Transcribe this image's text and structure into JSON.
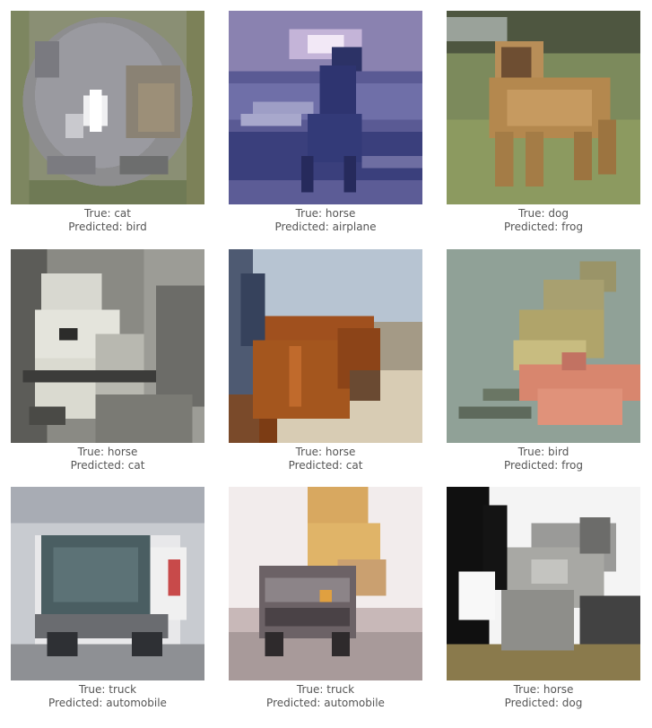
{
  "panels": [
    {
      "true_label": "True: cat",
      "predicted_label": "Predicted: bird",
      "subject": "cat"
    },
    {
      "true_label": "True: horse",
      "predicted_label": "Predicted: airplane",
      "subject": "horse"
    },
    {
      "true_label": "True: dog",
      "predicted_label": "Predicted: frog",
      "subject": "dog"
    },
    {
      "true_label": "True: horse",
      "predicted_label": "Predicted: cat",
      "subject": "horse"
    },
    {
      "true_label": "True: horse",
      "predicted_label": "Predicted: cat",
      "subject": "horse"
    },
    {
      "true_label": "True: bird",
      "predicted_label": "Predicted: frog",
      "subject": "bird"
    },
    {
      "true_label": "True: truck",
      "predicted_label": "Predicted: automobile",
      "subject": "truck"
    },
    {
      "true_label": "True: truck",
      "predicted_label": "Predicted: automobile",
      "subject": "truck"
    },
    {
      "true_label": "True: horse",
      "predicted_label": "Predicted: dog",
      "subject": "horse"
    }
  ]
}
